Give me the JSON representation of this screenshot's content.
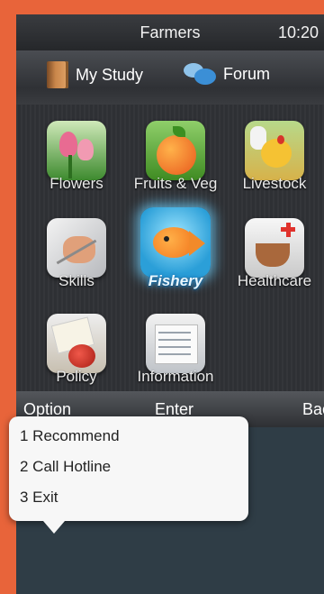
{
  "status": {
    "title": "Farmers",
    "time": "10:20"
  },
  "tabs": [
    {
      "label": "My Study",
      "icon": "book-icon"
    },
    {
      "label": "Forum",
      "icon": "chat-bubbles-icon"
    }
  ],
  "apps": [
    {
      "label": "Flowers",
      "icon": "flowers-icon"
    },
    {
      "label": "Fruits & Veg",
      "icon": "fruits-veg-icon"
    },
    {
      "label": "Livestock",
      "icon": "livestock-icon"
    },
    {
      "label": "Skills",
      "icon": "skills-icon"
    },
    {
      "label": "Fishery",
      "icon": "fishery-icon",
      "selected": true
    },
    {
      "label": "Healthcare",
      "icon": "healthcare-icon"
    },
    {
      "label": "Policy",
      "icon": "policy-icon"
    },
    {
      "label": "Information",
      "icon": "information-icon"
    }
  ],
  "softkeys": {
    "left": "Option",
    "center": "Enter",
    "right": "Back"
  },
  "menu": {
    "items": [
      "1 Recommend",
      "2 Call Hotline",
      "3 Exit"
    ]
  },
  "colors": {
    "frame": "#e8643a",
    "highlight": "#6fd2ff",
    "menu_bg": "#f7f7f7"
  }
}
